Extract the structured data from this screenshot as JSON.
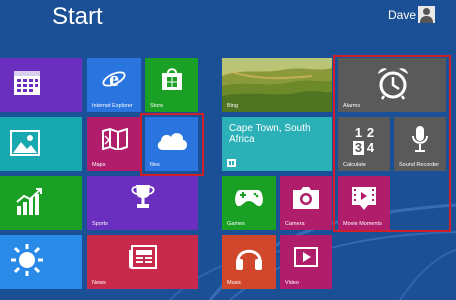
{
  "screen": {
    "title": "Start",
    "user": "Dave"
  },
  "tiles": {
    "calendar": {
      "label": ""
    },
    "internet_explorer": {
      "label": "Internet Explorer"
    },
    "store": {
      "label": "Store"
    },
    "photos": {
      "label": ""
    },
    "maps": {
      "label": "Maps"
    },
    "files": {
      "label": "files"
    },
    "finance": {
      "label": ""
    },
    "sports": {
      "label": "Sports"
    },
    "weather": {
      "label": ""
    },
    "news": {
      "label": "News"
    },
    "bing": {
      "label": "Bing"
    },
    "weather_live": {
      "label": "Cape Town, South Africa"
    },
    "games": {
      "label": "Games"
    },
    "camera": {
      "label": "Camera"
    },
    "music": {
      "label": "Music"
    },
    "video": {
      "label": "Video"
    },
    "alarms": {
      "label": "Alarms"
    },
    "calculator": {
      "label": "Calculate",
      "digits": [
        "1",
        "2",
        "3",
        "4"
      ]
    },
    "sound_recorder": {
      "label": "Sound Recorder"
    },
    "movie_moments": {
      "label": "Movie Moments"
    }
  },
  "colors": {
    "background": "#1b4f96",
    "purple": "#6a2fbf",
    "blue": "#2a74e0",
    "green": "#1aa024",
    "teal": "#17a8b0",
    "magenta": "#b01d6a",
    "crimson": "#c72a4a",
    "red": "#d0472c",
    "grey": "#5a5a5a",
    "highlight": "#d0202a"
  }
}
